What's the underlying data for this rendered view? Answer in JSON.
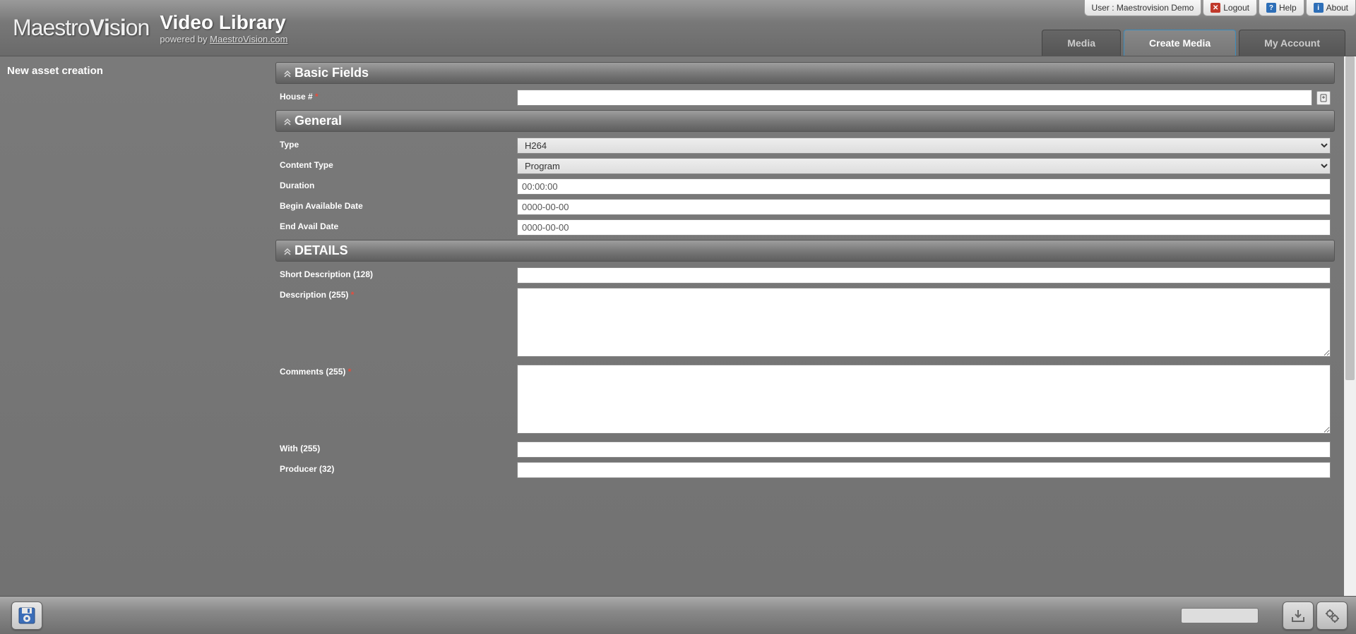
{
  "userbar": {
    "user_label": "User : Maestrovision Demo",
    "logout": "Logout",
    "help": "Help",
    "about": "About"
  },
  "header": {
    "logo": "MaestroVision",
    "title": "Video Library",
    "subtitle_prefix": "powered by ",
    "subtitle_link": "MaestroVision.com"
  },
  "tabs": {
    "media": "Media",
    "create_media": "Create Media",
    "my_account": "My Account"
  },
  "sidebar": {
    "title": "New asset creation"
  },
  "sections": {
    "basic": {
      "title": "Basic Fields",
      "house_label": "House #",
      "house_value": ""
    },
    "general": {
      "title": "General",
      "type_label": "Type",
      "type_value": "H264",
      "content_type_label": "Content Type",
      "content_type_value": "Program",
      "duration_label": "Duration",
      "duration_value": "00:00:00",
      "begin_date_label": "Begin Available Date",
      "begin_date_value": "0000-00-00",
      "end_date_label": "End Avail Date",
      "end_date_value": "0000-00-00"
    },
    "details": {
      "title": "DETAILS",
      "short_desc_label": "Short Description (128)",
      "short_desc_value": "",
      "desc_label": "Description (255)",
      "desc_value": "",
      "comments_label": "Comments (255)",
      "comments_value": "",
      "with_label": "With (255)",
      "with_value": "",
      "producer_label": "Producer (32)",
      "producer_value": ""
    }
  }
}
